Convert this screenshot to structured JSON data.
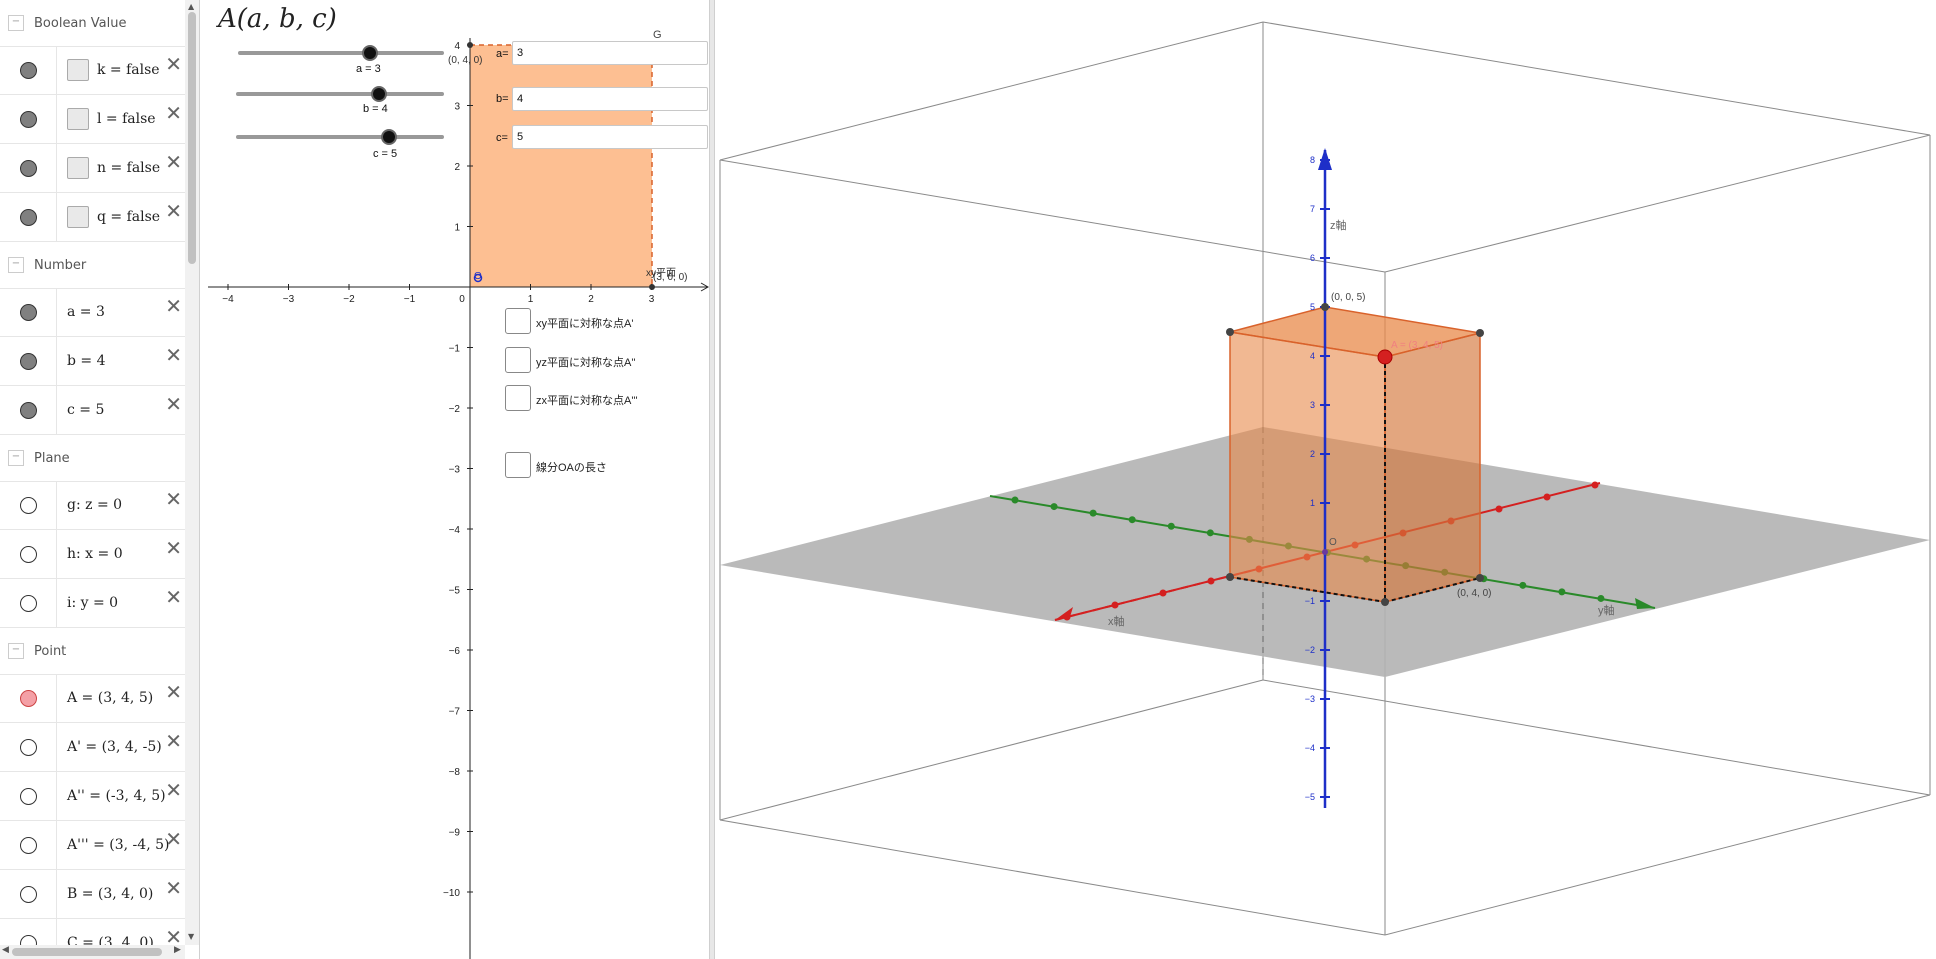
{
  "algebra": {
    "categories": {
      "boolean": "Boolean Value",
      "number": "Number",
      "plane": "Plane",
      "point": "Point"
    },
    "booleans": [
      {
        "text": "k = false"
      },
      {
        "text": "l = false"
      },
      {
        "text": "n = false"
      },
      {
        "text": "q = false"
      }
    ],
    "numbers": [
      {
        "text": "a = 3"
      },
      {
        "text": "b = 4"
      },
      {
        "text": "c = 5"
      }
    ],
    "planes": [
      {
        "text": "g: z = 0"
      },
      {
        "text": "h: x = 0"
      },
      {
        "text": "i: y = 0"
      }
    ],
    "points": [
      {
        "text": "A = (3, 4, 5)"
      },
      {
        "text": "A' = (3, 4, -5)"
      },
      {
        "text": "A'' = (-3, 4, 5)"
      },
      {
        "text": "A''' = (3, -4, 5)"
      },
      {
        "text": "B = (3, 4, 0)"
      },
      {
        "text": "C = (3, 4, 0)"
      }
    ],
    "delete_glyph": "✕"
  },
  "graphics2d": {
    "title": "A(a, b, c)",
    "sliders": [
      {
        "label": "a = 3",
        "value": 3
      },
      {
        "label": "b = 4",
        "value": 4
      },
      {
        "label": "c = 5",
        "value": 5
      }
    ],
    "inputs": [
      {
        "label": "a=",
        "value": "3"
      },
      {
        "label": "b=",
        "value": "4"
      },
      {
        "label": "c=",
        "value": "5"
      }
    ],
    "checkboxes": [
      {
        "label": "xy平面に対称な点A'"
      },
      {
        "label": "yz平面に対称な点A''"
      },
      {
        "label": "zx平面に対称な点A'''"
      },
      {
        "label": "線分OAの長さ"
      }
    ],
    "point_labels": {
      "top_left": "(0, 4, 0)",
      "G": "G",
      "O": "O",
      "xy_plane": "xy平面",
      "right": "(3, 0, 0)"
    },
    "x_ticks": [
      "−4",
      "−3",
      "−2",
      "−1",
      "0",
      "1",
      "2",
      "3"
    ],
    "y_ticks": [
      "4",
      "3",
      "2",
      "1",
      "−1",
      "−2",
      "−3",
      "−4",
      "−5",
      "−6",
      "−7",
      "−8",
      "−9",
      "−10"
    ],
    "colors": {
      "region": "#fdbf92",
      "region_border": "#d9622b"
    }
  },
  "graphics3d": {
    "labels": {
      "z_axis": "z軸",
      "x_axis": "x軸",
      "y_axis": "y軸",
      "p005": "(0, 0, 5)",
      "p040": "(0, 4, 0)",
      "O": "O",
      "pointA": "A = (3, 4, 5)"
    },
    "z_ticks": [
      "8",
      "7",
      "6",
      "5",
      "4",
      "3",
      "2",
      "1",
      "−1",
      "−2",
      "−3",
      "−4",
      "−5"
    ],
    "colors": {
      "box": "#e8894a",
      "plane": "#b3b3b3",
      "x_axis": "#d42020",
      "y_axis": "#2a8a2a",
      "z_axis": "#1e2fc8"
    }
  }
}
